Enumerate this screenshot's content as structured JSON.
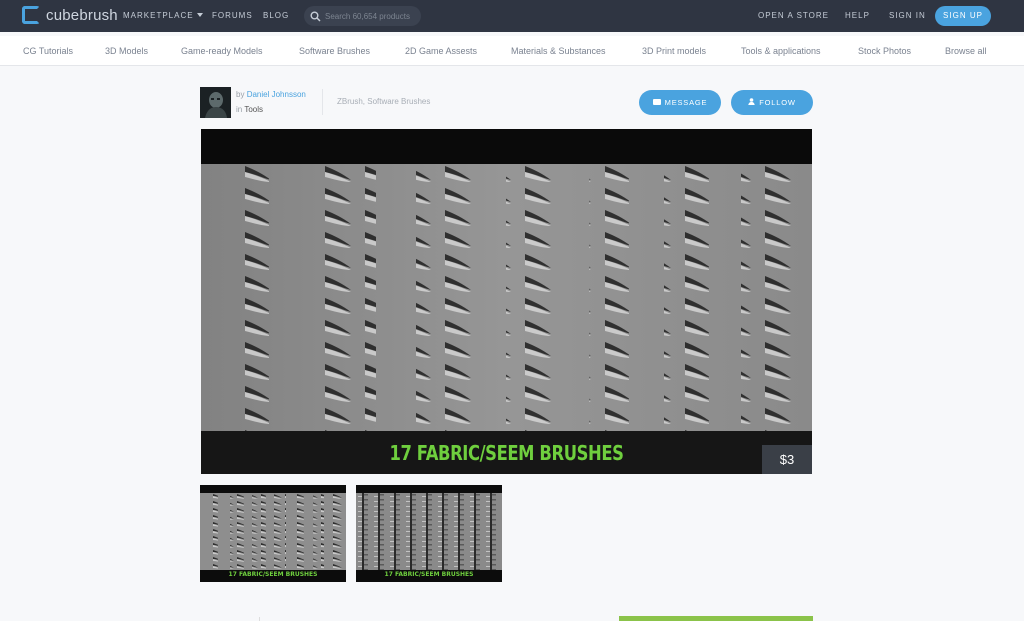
{
  "header": {
    "logo_text": "cubebrush",
    "nav": {
      "marketplace": "MARKETPLACE",
      "forums": "FORUMS",
      "blog": "BLOG"
    },
    "search_placeholder": "Search 60,654 products",
    "right": {
      "open_store": "OPEN A STORE",
      "help": "HELP",
      "sign_in": "SIGN IN",
      "sign_up": "SIGN UP"
    }
  },
  "categories": [
    "CG Tutorials",
    "3D Models",
    "Game-ready Models",
    "Software Brushes",
    "2D Game Assests",
    "Materials & Substances",
    "3D Print models",
    "Tools & applications",
    "Stock Photos",
    "Browse all"
  ],
  "product": {
    "by_prefix": "by",
    "author": "Daniel Johnsson",
    "in_prefix": "in",
    "category": "Tools",
    "tags": "ZBrush, Software Brushes",
    "message_label": "MESSAGE",
    "follow_label": "FOLLOW",
    "title": "17 FABRIC/SEEM BRUSHES",
    "price": "$3",
    "thumbs": [
      {
        "label": "17 FABRIC/SEEM BRUSHES"
      },
      {
        "label": "17 FABRIC/SEEM BRUSHES"
      }
    ]
  },
  "colors": {
    "topbar": "#2f3542",
    "accent": "#4aa3df",
    "title_green": "#6fcf3e"
  }
}
